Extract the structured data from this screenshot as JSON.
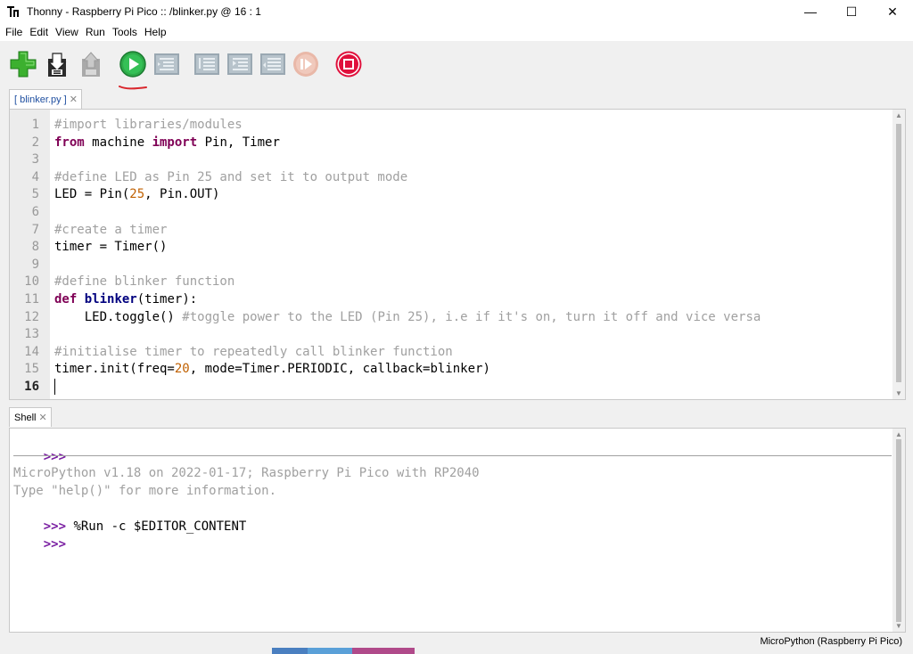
{
  "window": {
    "title": "Thonny  -  Raspberry Pi Pico :: /blinker.py  @  16 : 1",
    "minimize": "—",
    "maximize": "☐",
    "close": "✕"
  },
  "menu": [
    "File",
    "Edit",
    "View",
    "Run",
    "Tools",
    "Help"
  ],
  "toolbar": {
    "new": "new-file",
    "open": "open-file",
    "save": "save-file",
    "run": "run-current-script",
    "debug": "debug-script",
    "step_over": "step-over",
    "step_into": "step-into",
    "step_out": "step-out",
    "resume": "resume",
    "stop": "stop-restart-backend",
    "colors": {
      "new_green": "#3cb02f",
      "run_green": "#2eaa49",
      "stop_red": "#e0103c",
      "disabled_gray": "#9aa8b2",
      "annotation_red": "#d9262c"
    }
  },
  "editor": {
    "tab_label": "[ blinker.py ]",
    "tab_close": "✕",
    "current_line": 16,
    "lines": [
      {
        "num": "1",
        "segments": [
          {
            "t": "#import libraries/modules",
            "c": "cmt"
          }
        ]
      },
      {
        "num": "2",
        "segments": [
          {
            "t": "from",
            "c": "kw"
          },
          {
            "t": " machine ",
            "c": ""
          },
          {
            "t": "import",
            "c": "kw"
          },
          {
            "t": " Pin, Timer",
            "c": ""
          }
        ]
      },
      {
        "num": "3",
        "segments": []
      },
      {
        "num": "4",
        "segments": [
          {
            "t": "#define LED as Pin 25 and set it to output mode",
            "c": "cmt"
          }
        ]
      },
      {
        "num": "5",
        "segments": [
          {
            "t": "LED = Pin(",
            "c": ""
          },
          {
            "t": "25",
            "c": "numv"
          },
          {
            "t": ", Pin.OUT)",
            "c": ""
          }
        ]
      },
      {
        "num": "6",
        "segments": []
      },
      {
        "num": "7",
        "segments": [
          {
            "t": "#create a timer",
            "c": "cmt"
          }
        ]
      },
      {
        "num": "8",
        "segments": [
          {
            "t": "timer = Timer()",
            "c": ""
          }
        ]
      },
      {
        "num": "9",
        "segments": []
      },
      {
        "num": "10",
        "segments": [
          {
            "t": "#define blinker function",
            "c": "cmt"
          }
        ]
      },
      {
        "num": "11",
        "segments": [
          {
            "t": "def",
            "c": "kw"
          },
          {
            "t": " ",
            "c": ""
          },
          {
            "t": "blinker",
            "c": "fn"
          },
          {
            "t": "(timer):",
            "c": ""
          }
        ]
      },
      {
        "num": "12",
        "segments": [
          {
            "t": "    LED.toggle() ",
            "c": ""
          },
          {
            "t": "#toggle power to the LED (Pin 25), i.e if it's on, turn it off and vice versa",
            "c": "cmt"
          }
        ]
      },
      {
        "num": "13",
        "segments": []
      },
      {
        "num": "14",
        "segments": [
          {
            "t": "#initialise timer to repeatedly call blinker function",
            "c": "cmt"
          }
        ]
      },
      {
        "num": "15",
        "segments": [
          {
            "t": "timer.init(freq=",
            "c": ""
          },
          {
            "t": "20",
            "c": "numv"
          },
          {
            "t": ", mode=Timer.PERIODIC, callback=blinker)",
            "c": ""
          }
        ]
      },
      {
        "num": "16",
        "segments": []
      }
    ]
  },
  "shell": {
    "tab_label": "Shell",
    "tab_close": "✕",
    "prompt": ">>>",
    "banner_line1": "MicroPython v1.18 on 2022-01-17; Raspberry Pi Pico with RP2040",
    "banner_line2": "Type \"help()\" for more information.",
    "run_command": " %Run -c $EDITOR_CONTENT"
  },
  "status": {
    "interpreter": "MicroPython (Raspberry Pi Pico)"
  }
}
